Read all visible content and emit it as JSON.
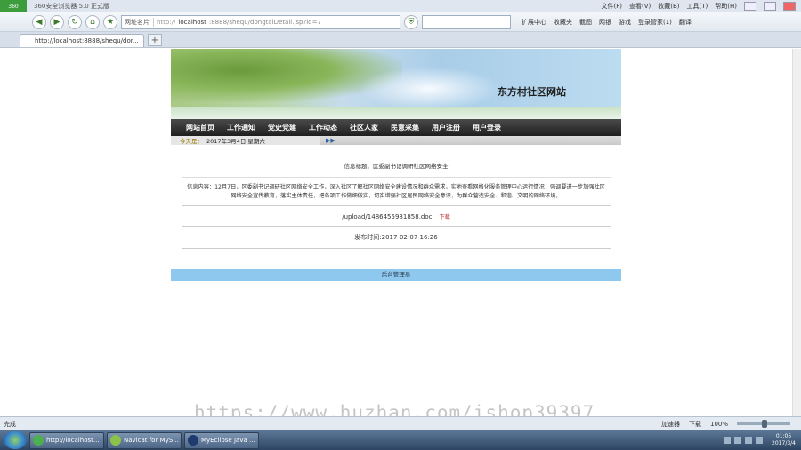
{
  "browser": {
    "title": "360安全浏览器 5.0 正式版",
    "logo_text": "360",
    "menus": [
      "文件(F)",
      "查看(V)",
      "收藏(B)",
      "工具(T)",
      "帮助(H)"
    ],
    "url_site_tag": "网址名片",
    "url_proto": "http://",
    "url_host": "localhost",
    "url_rest": ":8888/shequ/dongtaiDetail.jsp?id=7",
    "toolbar_links": [
      "扩展中心",
      "收藏夹",
      "截图",
      "网银",
      "游戏",
      "登录管家(1)",
      "翻译"
    ],
    "tab_label": "http://localhost:8888/shequ/dor...",
    "new_tab": "+"
  },
  "site": {
    "name": "东方村社区网站",
    "nav": [
      "网站首页",
      "工作通知",
      "党史党建",
      "工作动态",
      "社区人家",
      "民意采集",
      "用户注册",
      "用户登录"
    ],
    "today_label": "今天是：",
    "date": "2017年3月4日 星期六",
    "arrow": "▶▶"
  },
  "detail": {
    "title": "信息标题：区委副书记调研社区网络安全",
    "body": "信息内容：12月7日，区委副书记调研社区网络安全工作，深入社区了解社区网络安全建设情况和群众需求，实地查看网格化服务管理中心运行情况，强调要进一步加强社区网络安全宣传教育，落实主体责任，把各项工作做细做实，切实增强社区居民网络安全意识，为群众营造安全、和谐、文明的网络环境。",
    "file": "/upload/1486455981858.doc",
    "download": "下载",
    "publish_time": "发布时间:2017-02-07 16:26"
  },
  "footer": {
    "text": "后台管理员"
  },
  "status": {
    "left": "完成",
    "items": [
      "加速器",
      "下载",
      "100%"
    ]
  },
  "watermark": "https://www.huzhan.com/ishop39397",
  "taskbar": {
    "tasks": [
      {
        "label": "http://localhost...",
        "color": "#4caf50"
      },
      {
        "label": "Navicat for MyS...",
        "color": "#8bc34a"
      },
      {
        "label": "MyEclipse Java ...",
        "color": "#1e3a6e"
      }
    ],
    "time": "01:05",
    "date": "2017/3/4"
  }
}
